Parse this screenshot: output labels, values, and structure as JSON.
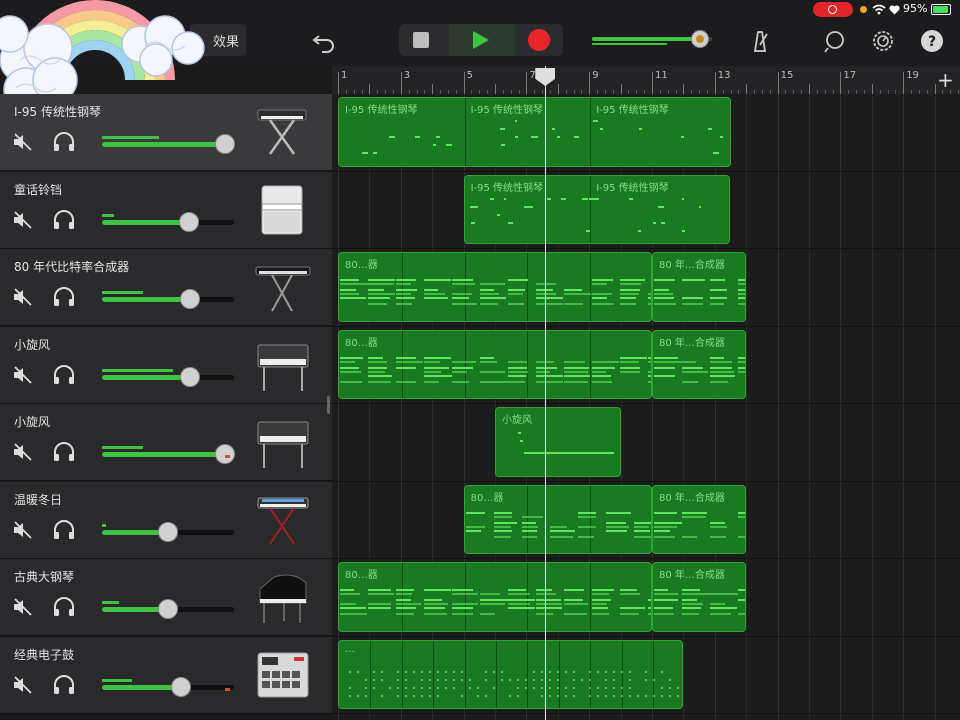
{
  "status_bar": {
    "battery": "95%"
  },
  "toolbar": {
    "effects_label": "效果",
    "undo_icon": "undo-icon",
    "metronome_icon": "metronome-icon",
    "loop_icon": "loop-browser-icon",
    "settings_icon": "settings-icon",
    "help_label": "?",
    "master_volume": 0.9,
    "colors": {
      "record": "#e8272b",
      "play": "#3ec43e",
      "accent_green": "#3ec43e"
    }
  },
  "ruler": {
    "bars": [
      "1",
      "3",
      "5",
      "7",
      "9",
      "11",
      "13",
      "15",
      "17",
      "19"
    ],
    "add_label": "+"
  },
  "tracks": [
    {
      "name": "I-95 传统性钢琴",
      "volume": 0.93,
      "meter": 0.43,
      "instrument": "keyboard-stand"
    },
    {
      "name": "童话铃铛",
      "volume": 0.66,
      "meter": 0.09,
      "instrument": "upright-piano"
    },
    {
      "name": "80 年代比特率合成器",
      "volume": 0.67,
      "meter": 0.31,
      "instrument": "synth-stand"
    },
    {
      "name": "小旋风",
      "volume": 0.67,
      "meter": 0.54,
      "instrument": "electric-piano"
    },
    {
      "name": "小旋风",
      "volume": 0.93,
      "meter": 0.31,
      "instrument": "electric-piano"
    },
    {
      "name": "温暖冬日",
      "volume": 0.5,
      "meter": 0.03,
      "instrument": "workstation-stand"
    },
    {
      "name": "古典大钢琴",
      "volume": 0.5,
      "meter": 0.13,
      "instrument": "grand-piano"
    },
    {
      "name": "经典电子鼓",
      "volume": 0.6,
      "meter": 0.23,
      "instrument": "drum-machine"
    }
  ],
  "regions": [
    {
      "track": 0,
      "start": 1,
      "end": 13.5,
      "segments": [
        1,
        5,
        9
      ],
      "label": "I-95 传统性钢琴",
      "style": "keys"
    },
    {
      "track": 1,
      "start": 5,
      "end": 13.5,
      "segments": [
        5,
        9
      ],
      "label": "I-95 传统性钢琴",
      "style": "keys"
    },
    {
      "track": 2,
      "start": 1,
      "end": 11,
      "segments": [
        1,
        3,
        5,
        7,
        9
      ],
      "label": "80…器",
      "style": "synth"
    },
    {
      "track": 2,
      "start": 11,
      "end": 14,
      "segments": [
        11
      ],
      "label": "80 年…合成器",
      "style": "synth"
    },
    {
      "track": 3,
      "start": 1,
      "end": 11,
      "segments": [
        1,
        3,
        5,
        7,
        9
      ],
      "label": "80…器",
      "style": "synth"
    },
    {
      "track": 3,
      "start": 11,
      "end": 14,
      "segments": [
        11
      ],
      "label": "80 年…合成器",
      "style": "synth"
    },
    {
      "track": 4,
      "start": 6,
      "end": 10,
      "segments": [
        6
      ],
      "label": "小旋风",
      "style": "sparse"
    },
    {
      "track": 5,
      "start": 5,
      "end": 11,
      "segments": [
        5,
        7,
        9
      ],
      "label": "80…器",
      "style": "synth"
    },
    {
      "track": 5,
      "start": 11,
      "end": 14,
      "segments": [
        11
      ],
      "label": "80 年…合成器",
      "style": "synth"
    },
    {
      "track": 6,
      "start": 1,
      "end": 11,
      "segments": [
        1,
        3,
        5,
        7,
        9
      ],
      "label": "80…器",
      "style": "synth"
    },
    {
      "track": 6,
      "start": 11,
      "end": 14,
      "segments": [
        11
      ],
      "label": "80 年…合成器",
      "style": "synth"
    },
    {
      "track": 7,
      "start": 1,
      "end": 12,
      "segments": [
        1,
        2,
        3,
        4,
        5,
        6,
        7,
        8,
        9,
        10,
        11
      ],
      "label": "…",
      "style": "drums"
    }
  ],
  "playhead_bar": 7.6
}
